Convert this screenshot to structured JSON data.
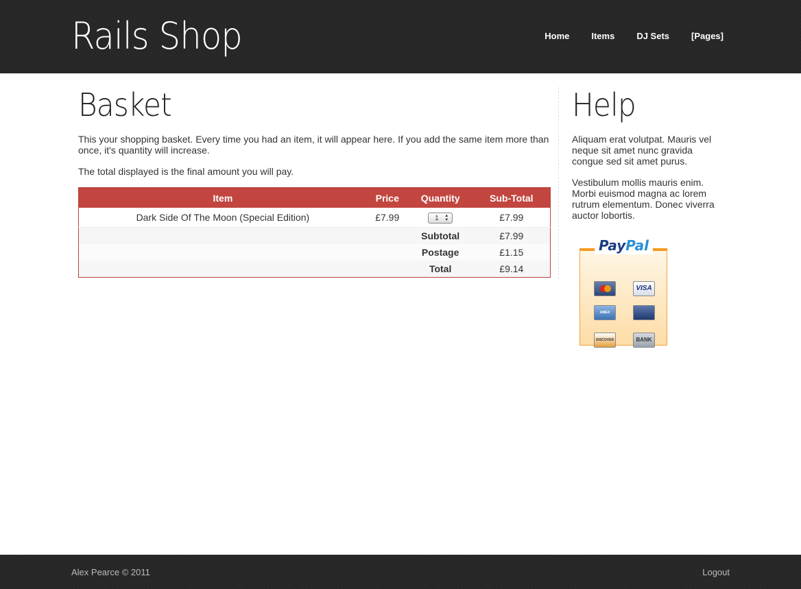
{
  "site": {
    "title": "Rails Shop"
  },
  "nav": {
    "items": [
      "Home",
      "Items",
      "DJ Sets",
      "[Pages]"
    ]
  },
  "basket": {
    "title": "Basket",
    "intro": [
      "This your shopping basket. Every time you had an item, it will appear here. If you add the same item more than once, it's quantity will increase.",
      "The total displayed is the final amount you will pay."
    ],
    "columns": [
      "Item",
      "Price",
      "Quantity",
      "Sub-Total"
    ],
    "items": [
      {
        "name": "Dark Side Of The Moon (Special Edition)",
        "price": "£7.99",
        "quantity": "1",
        "subtotal": "£7.99"
      }
    ],
    "summary": [
      {
        "label": "Subtotal",
        "value": "£7.99"
      },
      {
        "label": "Postage",
        "value": "£1.15"
      },
      {
        "label": "Total",
        "value": "£9.14"
      }
    ]
  },
  "help": {
    "title": "Help",
    "paragraphs": [
      "Aliquam erat volutpat. Mauris vel neque sit amet nunc gravida congue sed sit amet purus.",
      "Vestibulum mollis mauris enim. Morbi euismod magna ac lorem rutrum elementum. Donec viverra auctor lobortis."
    ]
  },
  "paypal": {
    "brand_pay": "Pay",
    "brand_pal": "Pal",
    "cards": [
      "MasterCard",
      "VISA",
      "AMERICAN EXPRESS",
      "Credit",
      "DISCOVER",
      "BANK"
    ]
  },
  "footer": {
    "copyright": "Alex Pearce © 2011",
    "logout": "Logout"
  },
  "colors": {
    "header_bg": "#262626",
    "table_header": "#c2463f",
    "table_border": "#b5443e",
    "paypal_orange": "#f39a1f"
  }
}
